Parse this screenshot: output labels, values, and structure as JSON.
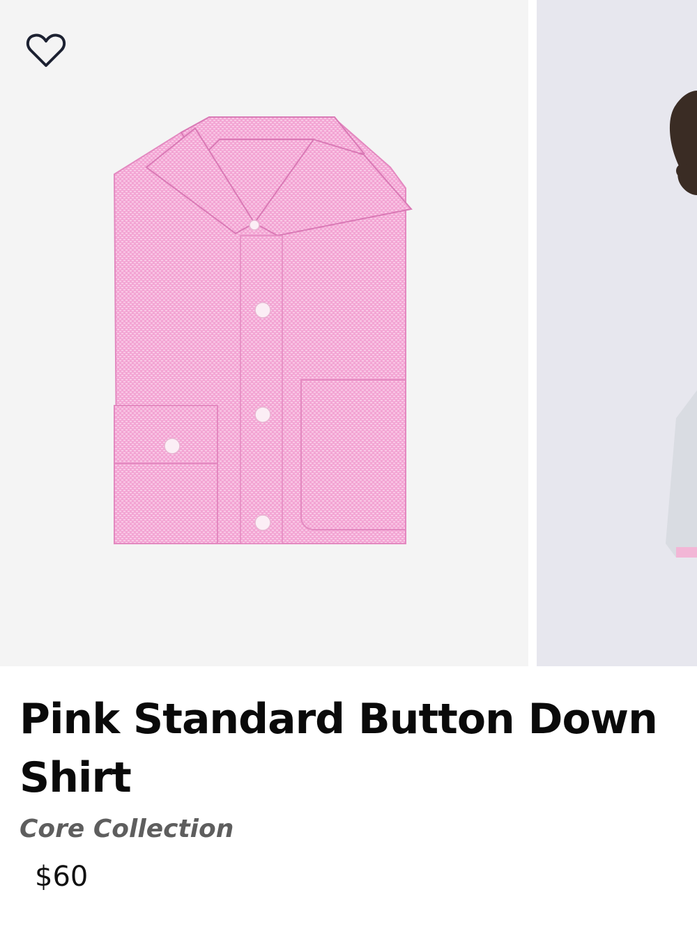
{
  "product": {
    "title": "Pink Standard Button Down Shirt",
    "collection": "Core Collection",
    "price": "$60"
  },
  "gallery": {
    "favorite_icon": "heart-outline-icon",
    "images": [
      {
        "subject": "folded pink shirt",
        "active": true
      },
      {
        "subject": "model wearing shirt",
        "active": false
      }
    ]
  },
  "colors": {
    "shirt_pink": "#f4a9d6",
    "shirt_pink_shadow": "#e58cc3",
    "photo_bg": "#f4f4f4",
    "second_photo_bg": "#e7e7ee",
    "collection_text": "#5e5e5e",
    "title_text": "#0a0a0a"
  }
}
